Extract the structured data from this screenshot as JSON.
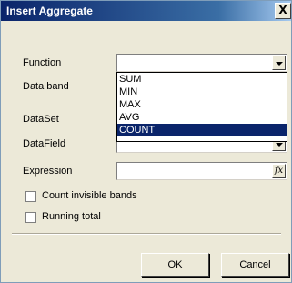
{
  "window": {
    "title": "Insert Aggregate",
    "close_label": "X"
  },
  "form": {
    "function_label": "Function",
    "function_value": "",
    "databand_label": "Data band",
    "dataset_label": "DataSet",
    "datafield_label": "DataField",
    "expression_label": "Expression",
    "expression_value": "",
    "fx_label": "fx"
  },
  "function_dropdown": {
    "options": [
      "SUM",
      "MIN",
      "MAX",
      "AVG",
      "COUNT"
    ],
    "selected": "COUNT"
  },
  "options": {
    "count_invisible_label": "Count invisible bands",
    "count_invisible_checked": false,
    "running_total_label": "Running total",
    "running_total_checked": false
  },
  "buttons": {
    "ok_label": "OK",
    "cancel_label": "Cancel"
  }
}
